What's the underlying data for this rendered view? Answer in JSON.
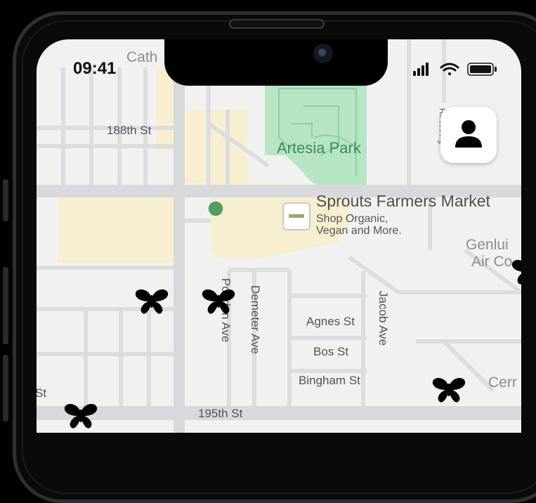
{
  "status_bar": {
    "time": "09:41",
    "signal_icon": "signal-bars-icon",
    "wifi_icon": "wifi-icon",
    "battery_icon": "battery-icon"
  },
  "map": {
    "streets": {
      "st_188th": "188th St",
      "st_195th": "195th St",
      "agnes": "Agnes St",
      "bos": "Bos St",
      "bingham": "Bingham St",
      "pioneer_partial": "Pondon Ave",
      "demeter": "Demeter Ave",
      "jacob": "Jacob Ave",
      "st_partial": "St",
      "cathedral_partial": "Cath",
      "vertical_partial": "Hindeberg"
    },
    "park": "Artesia Park",
    "business": {
      "name": "Sprouts Farmers Market",
      "subtitle_line1": "Shop Organic,",
      "subtitle_line2": "Vegan and More.",
      "logo_icon": "sprouts-logo-icon"
    },
    "partial_labels": {
      "genlui_line1": "Genlui",
      "genlui_line2": "Air Co",
      "cerr": "Cerr"
    },
    "markers": {
      "butterfly_icon": "butterfly-icon",
      "location_icon": "location-dot-icon"
    }
  },
  "profile_button": {
    "icon": "person-icon"
  },
  "colors": {
    "map_bg": "#f1f2f0",
    "road": "#d7d9dc",
    "park": "#b6e5c4",
    "zone": "#f7efcf",
    "pin": "#4fa062"
  }
}
